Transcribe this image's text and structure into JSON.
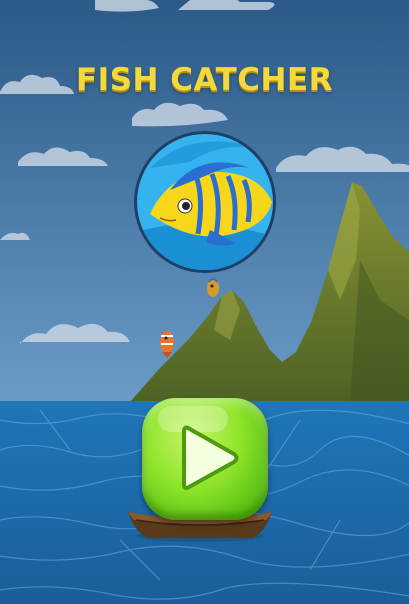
{
  "game": {
    "title": "FISH CATCHER"
  },
  "colors": {
    "sky_top": "#2e5d8c",
    "sky_bottom": "#5b8fbf",
    "sea": "#1d6aa8",
    "title": "#f5d93b",
    "play_button": "#7ed321",
    "logo_circle": "#2aa7e6",
    "logo_fish": "#f4d218",
    "mountain": "#6f7e2c"
  },
  "icons": {
    "logo": "fish-logo-icon",
    "play": "play-icon",
    "boat": "boat-icon",
    "falling_fish": "fish-icon"
  }
}
